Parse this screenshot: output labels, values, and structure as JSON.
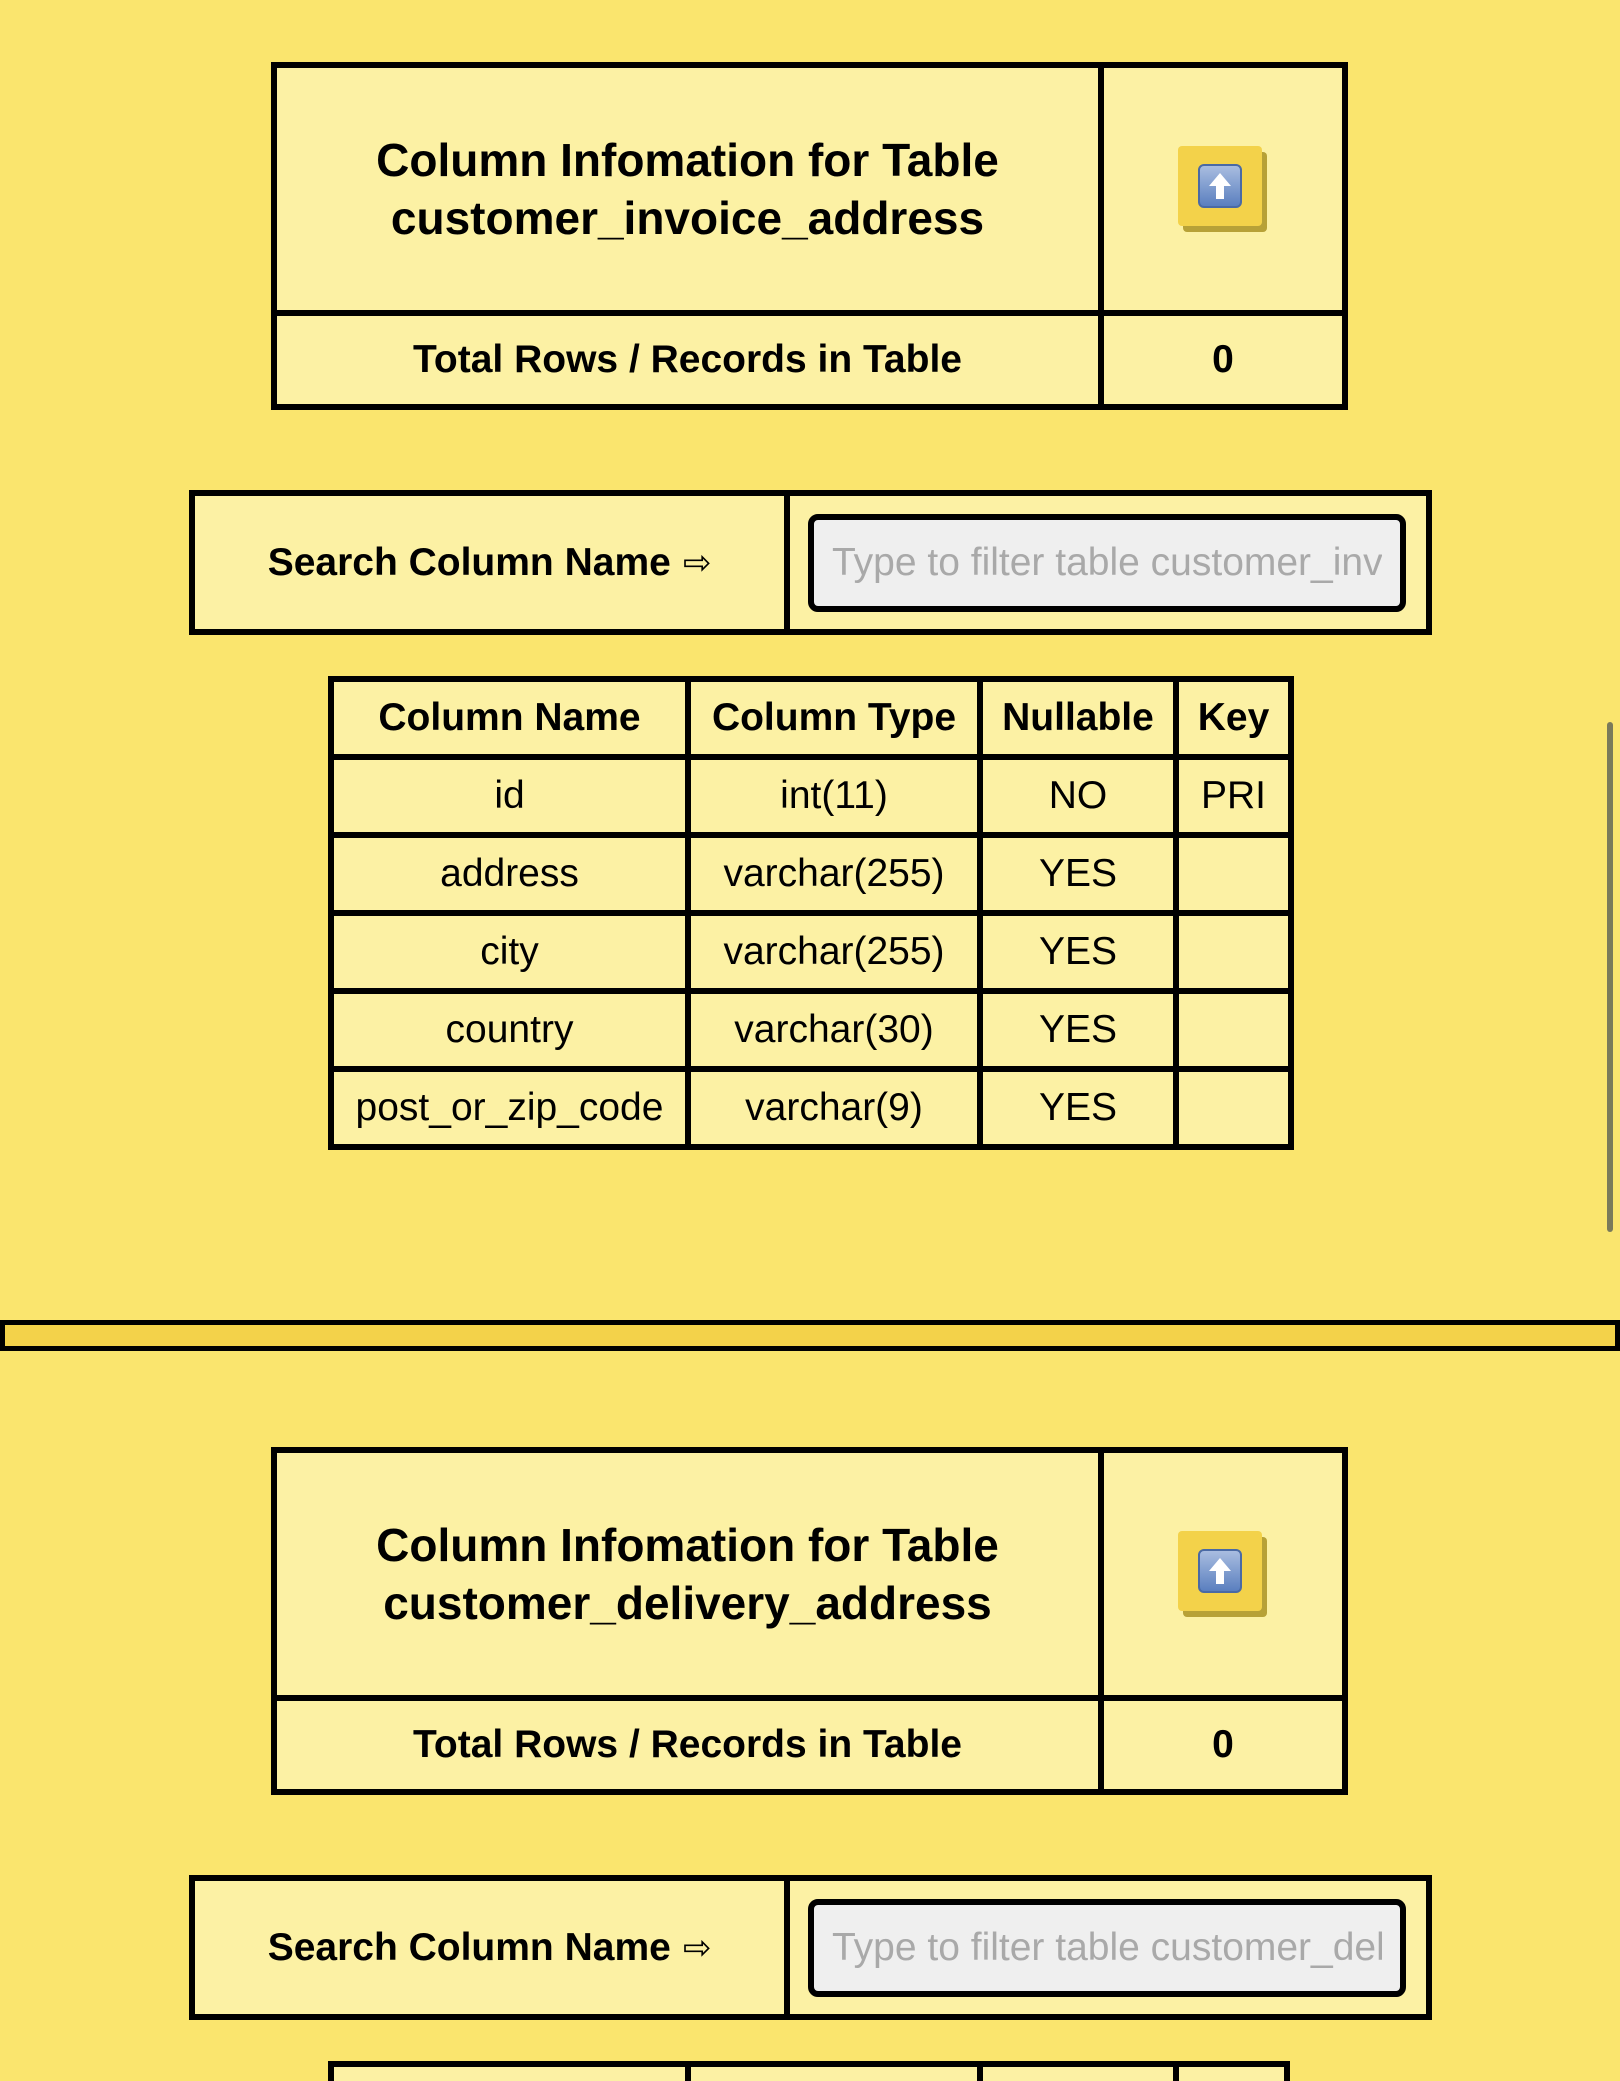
{
  "sections": [
    {
      "title_line1": "Column Infomation for Table",
      "title_line2": "customer_invoice_address",
      "rows_label": "Total Rows / Records in Table",
      "rows_value": "0",
      "search_label": "Search Column Name",
      "search_arrow": "⇨",
      "search_placeholder": "Type to filter table customer_invoice_address",
      "search_value": "",
      "headers": [
        "Column Name",
        "Column Type",
        "Nullable",
        "Key"
      ],
      "rows": [
        [
          "id",
          "int(11)",
          "NO",
          "PRI"
        ],
        [
          "address",
          "varchar(255)",
          "YES",
          ""
        ],
        [
          "city",
          "varchar(255)",
          "YES",
          ""
        ],
        [
          "country",
          "varchar(30)",
          "YES",
          ""
        ],
        [
          "post_or_zip_code",
          "varchar(9)",
          "YES",
          ""
        ]
      ]
    },
    {
      "title_line1": "Column Infomation for Table",
      "title_line2": "customer_delivery_address",
      "rows_label": "Total Rows / Records in Table",
      "rows_value": "0",
      "search_label": "Search Column Name",
      "search_arrow": "⇨",
      "search_placeholder": "Type to filter table customer_delivery_address",
      "search_value": ""
    }
  ],
  "icons": {
    "up_button": "arrow-up-icon"
  },
  "colors": {
    "page_background": "#fae56e",
    "cell_background": "#fcf1a4",
    "button_face": "#f3d24a",
    "border": "#000000",
    "placeholder": "#a9a9a9"
  }
}
